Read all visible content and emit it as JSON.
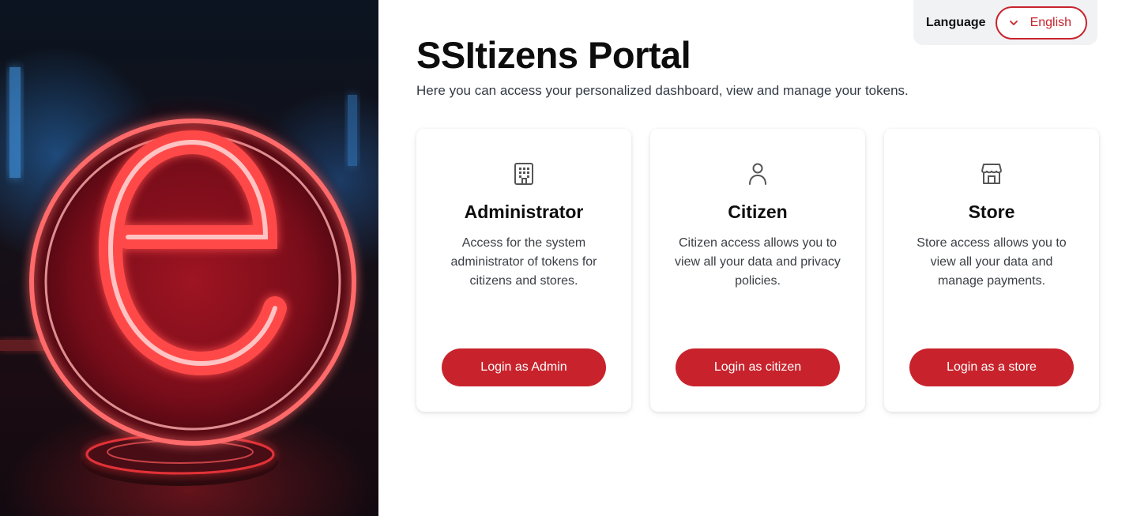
{
  "language": {
    "label": "Language",
    "selected": "English"
  },
  "header": {
    "title": "SSItizens Portal",
    "subtitle": "Here you can access your personalized dashboard, view and manage your tokens."
  },
  "cards": [
    {
      "icon": "building-icon",
      "title": "Administrator",
      "description": "Access for the system administrator of tokens for citizens and stores.",
      "button": "Login as Admin"
    },
    {
      "icon": "user-icon",
      "title": "Citizen",
      "description": "Citizen access allows you to view all your data and privacy policies.",
      "button": "Login as citizen"
    },
    {
      "icon": "store-icon",
      "title": "Store",
      "description": "Store access allows you to view all your data and manage payments.",
      "button": "Login as a store"
    }
  ],
  "colors": {
    "accent": "#c8232c",
    "background": "#ffffff",
    "language_panel": "#f1f2f4"
  }
}
